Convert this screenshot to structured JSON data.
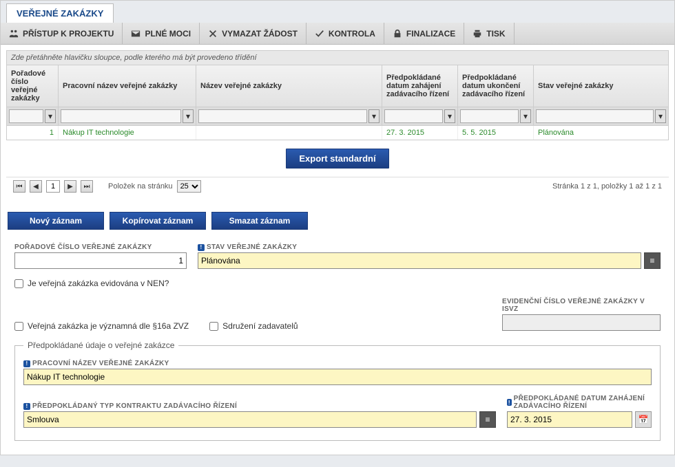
{
  "tab": {
    "title": "VEŘEJNÉ ZAKÁZKY"
  },
  "toolbar": {
    "items": [
      {
        "label": "PŘÍSTUP K PROJEKTU",
        "icon": "people"
      },
      {
        "label": "PLNÉ MOCI",
        "icon": "mail"
      },
      {
        "label": "VYMAZAT ŽÁDOST",
        "icon": "cross"
      },
      {
        "label": "KONTROLA",
        "icon": "check"
      },
      {
        "label": "FINALIZACE",
        "icon": "lock"
      },
      {
        "label": "TISK",
        "icon": "print"
      }
    ]
  },
  "grid": {
    "hint": "Zde přetáhněte hlavičku sloupce, podle kterého má být provedeno třídění",
    "columns": {
      "ord": "Pořadové číslo veřejné zakázky",
      "pname": "Pracovní název veřejné zakázky",
      "name": "Název veřejné zakázky",
      "d1": "Předpokládané datum zahájení zadávacího řízení",
      "d2": "Předpokládané datum ukončení zadávacího řízení",
      "stat": "Stav veřejné zakázky"
    },
    "rows": [
      {
        "ord": "1",
        "pname": "Nákup IT technologie",
        "name": "",
        "d1": "27. 3. 2015",
        "d2": "5. 5. 2015",
        "stat": "Plánována"
      }
    ],
    "export_label": "Export standardní",
    "pager": {
      "page": "1",
      "per_page_label": "Položek na stránku",
      "per_page": "25",
      "summary": "Stránka 1 z 1, položky 1 až 1 z 1"
    }
  },
  "actions": {
    "new": "Nový záznam",
    "copy": "Kopírovat záznam",
    "delete": "Smazat záznam"
  },
  "form": {
    "ord_label": "POŘADOVÉ ČÍSLO VEŘEJNÉ ZAKÁZKY",
    "ord_value": "1",
    "state_label": "STAV VEŘEJNÉ ZAKÁZKY",
    "state_value": "Plánována",
    "chk_nen": "Je veřejná zakázka evidována v NEN?",
    "chk_significant": "Veřejná zakázka je významná dle §16a ZVZ",
    "chk_assoc": "Sdružení zadavatelů",
    "evid_label": "EVIDENČNÍ ČÍSLO VEŘEJNÉ ZAKÁZKY V ISVZ",
    "evid_value": "",
    "fieldset_legend": "Předpokládané údaje o veřejné zakázce",
    "pname_label": "PRACOVNÍ NÁZEV VEŘEJNÉ ZAKÁZKY",
    "pname_value": "Nákup IT technologie",
    "contract_label": "PŘEDPOKLÁDANÝ TYP KONTRAKTU ZADÁVACÍHO ŘÍZENÍ",
    "contract_value": "Smlouva",
    "date_start_label": "PŘEDPOKLÁDANÉ DATUM ZAHÁJENÍ ZADÁVACÍHO ŘÍZENÍ",
    "date_start_value": "27. 3. 2015"
  }
}
